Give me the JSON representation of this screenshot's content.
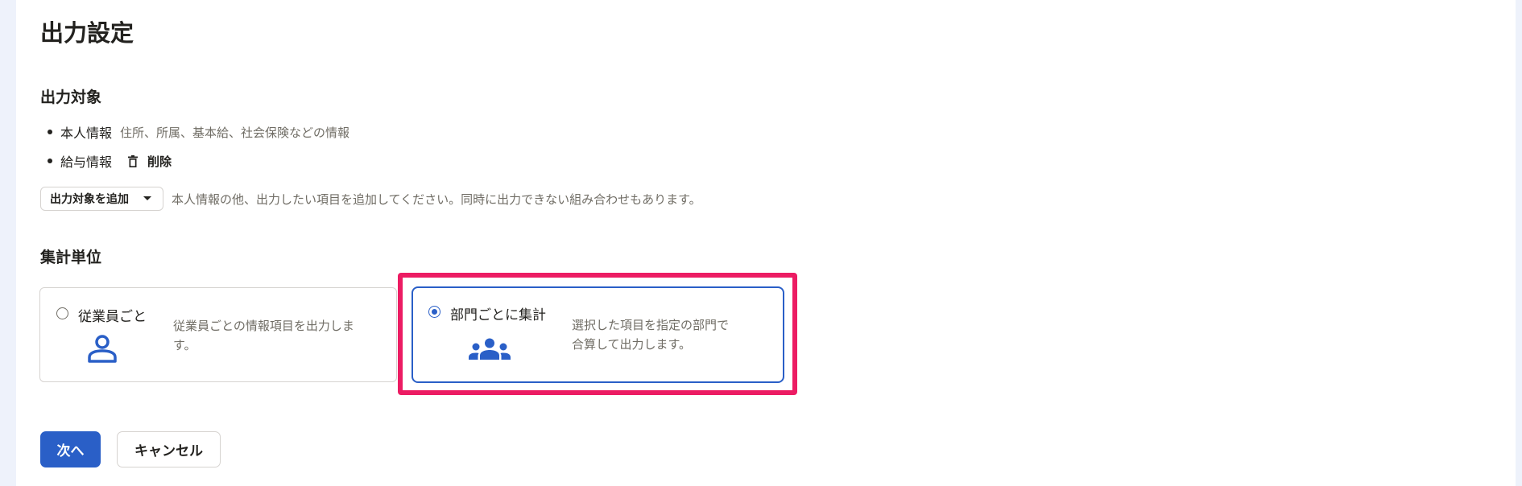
{
  "page": {
    "title": "出力設定"
  },
  "output_target": {
    "heading": "出力対象",
    "items": [
      {
        "name": "本人情報",
        "description": "住所、所属、基本給、社会保険などの情報"
      },
      {
        "name": "給与情報",
        "delete_label": "削除"
      }
    ],
    "add_button_label": "出力対象を追加",
    "add_hint": "本人情報の他、出力したい項目を追加してください。同時に出力できない組み合わせもあります。"
  },
  "aggregation": {
    "heading": "集計単位",
    "options": [
      {
        "label": "従業員ごと",
        "description_lines": [
          "従業員ごとの情報項目を出力しま",
          "す。"
        ],
        "selected": false,
        "icon": "person-icon"
      },
      {
        "label": "部門ごとに集計",
        "description_lines": [
          "選択した項目を指定の部門で",
          "合算して出力します。"
        ],
        "selected": true,
        "icon": "group-icon"
      }
    ]
  },
  "actions": {
    "next_label": "次へ",
    "cancel_label": "キャンセル"
  },
  "colors": {
    "primary": "#2a5fc7",
    "highlight": "#ec1c63",
    "text": "#23221f",
    "muted": "#706d65",
    "border": "#d6d3d0",
    "page_bg": "#eef2fb"
  }
}
